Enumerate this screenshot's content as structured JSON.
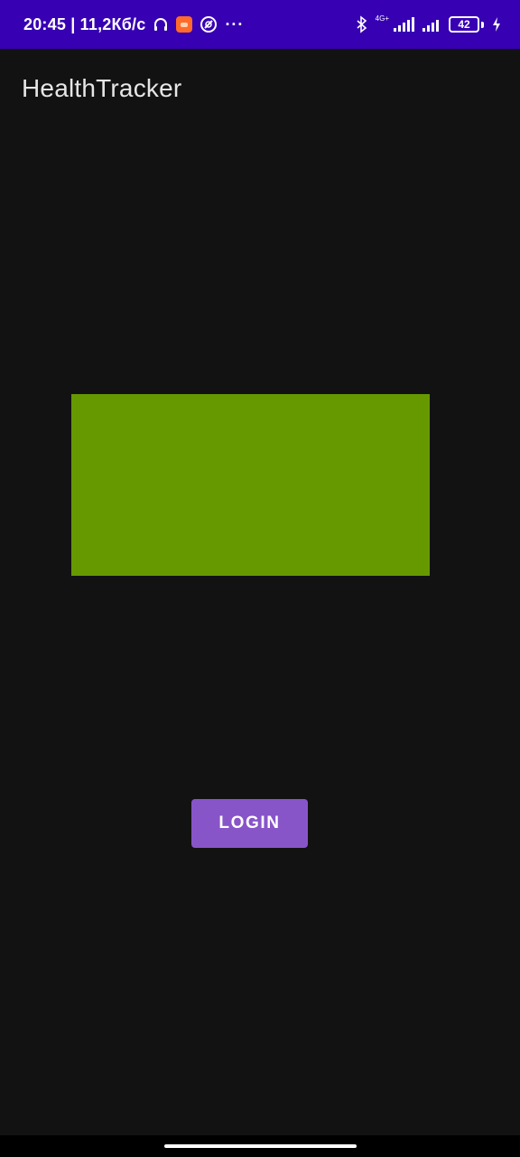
{
  "status_bar": {
    "time_and_speed": "20:45 | 11,2Кб/с",
    "network_label": "4G+",
    "battery_level": "42",
    "icons": [
      "headphones-icon",
      "app-badge-icon",
      "sync-icon",
      "more-icon",
      "bluetooth-icon",
      "signal-icon",
      "signal-icon",
      "battery-icon",
      "charging-icon"
    ],
    "more_glyph": "···"
  },
  "app_bar": {
    "title": "HealthTracker"
  },
  "content": {
    "panel_color": "#669900"
  },
  "login_button": {
    "label": "LOGIN",
    "color": "#8755c8"
  },
  "colors": {
    "status_bar": "#3700b3",
    "background": "#121212",
    "title_text": "#e6e6e6"
  }
}
